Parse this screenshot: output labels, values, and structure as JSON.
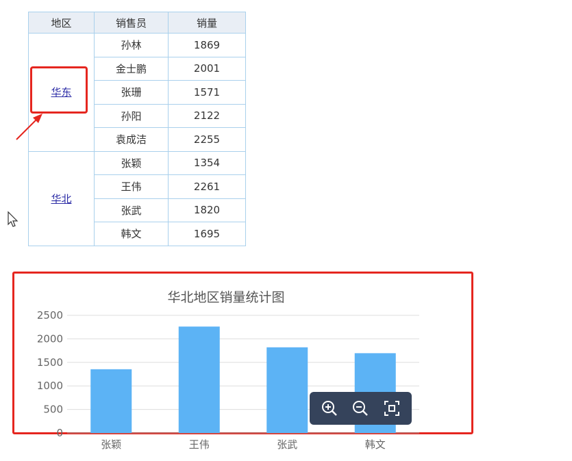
{
  "table": {
    "headers": [
      "地区",
      "销售员",
      "销量"
    ],
    "regions": [
      {
        "name": "华东",
        "rows": [
          {
            "seller": "孙林",
            "sales": "1869"
          },
          {
            "seller": "金士鹏",
            "sales": "2001"
          },
          {
            "seller": "张珊",
            "sales": "1571"
          },
          {
            "seller": "孙阳",
            "sales": "2122"
          },
          {
            "seller": "袁成洁",
            "sales": "2255"
          }
        ]
      },
      {
        "name": "华北",
        "rows": [
          {
            "seller": "张颖",
            "sales": "1354"
          },
          {
            "seller": "王伟",
            "sales": "2261"
          },
          {
            "seller": "张武",
            "sales": "1820"
          },
          {
            "seller": "韩文",
            "sales": "1695"
          }
        ]
      }
    ]
  },
  "chart_data": {
    "type": "bar",
    "title": "华北地区销量统计图",
    "categories": [
      "张颖",
      "王伟",
      "张武",
      "韩文"
    ],
    "values": [
      1354,
      2261,
      1820,
      1695
    ],
    "ylim": [
      0,
      2500
    ],
    "yticks": [
      "0",
      "500",
      "1000",
      "1500",
      "2000",
      "2500"
    ],
    "grid": true,
    "bar_color": "#5cb3f5"
  },
  "toolbar": {
    "icons": [
      "zoom-in-icon",
      "zoom-out-icon",
      "fit-screen-icon"
    ]
  },
  "colors": {
    "highlight": "#e5261f",
    "table_border": "#a9d0ec",
    "toolbar_bg": "#35435b"
  }
}
